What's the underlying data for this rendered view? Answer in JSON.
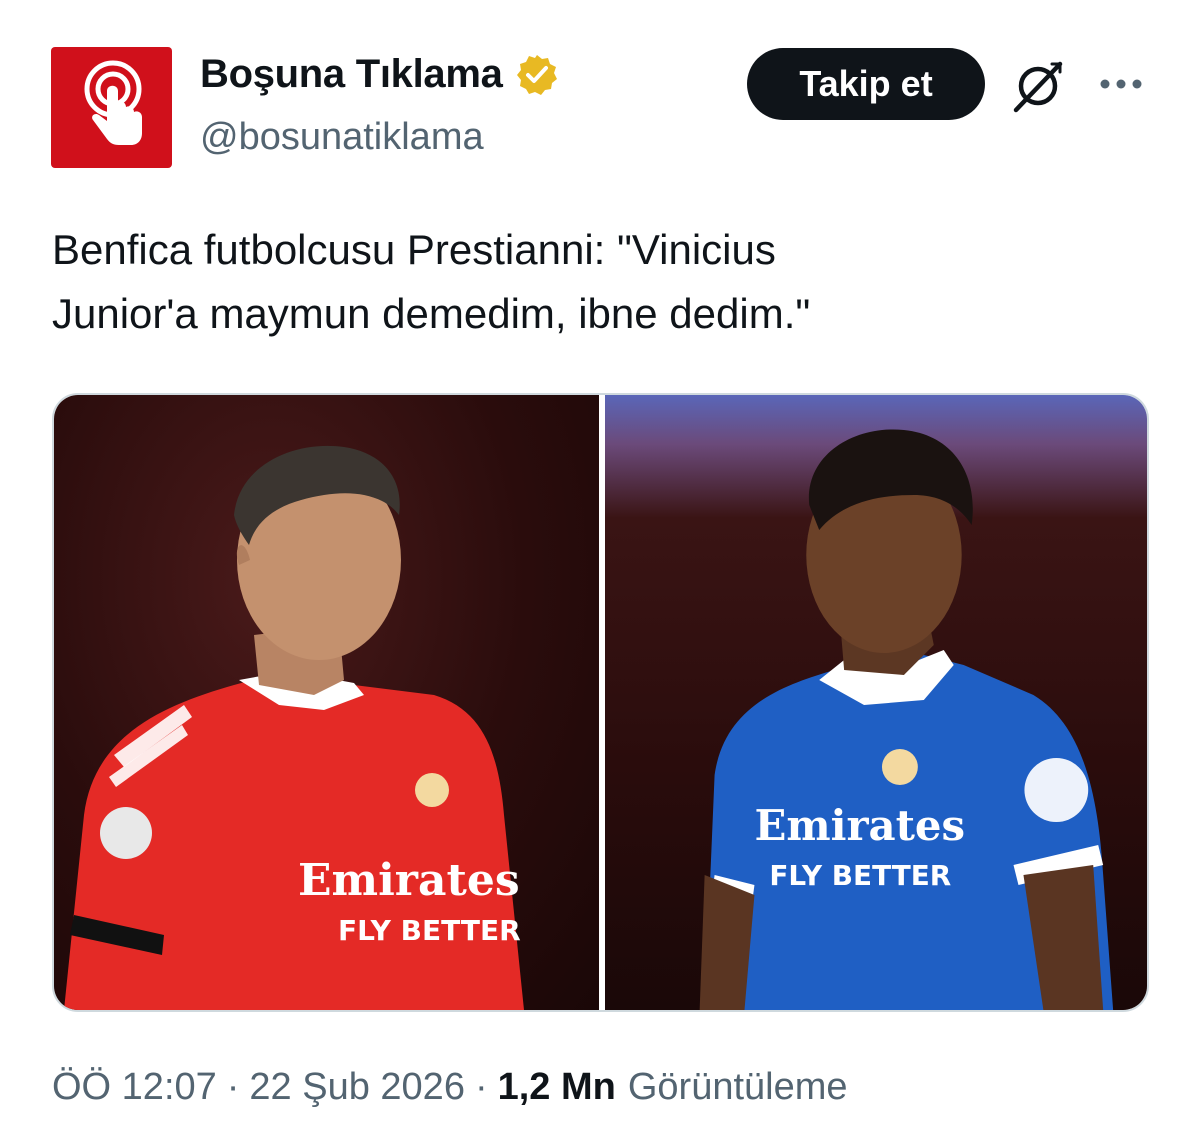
{
  "author": {
    "display_name": "Boşuna Tıklama",
    "handle": "@bosunatiklama",
    "verified_color": "#e8b923",
    "avatar_color": "#d0101b",
    "avatar_icon": "tap-hand-icon"
  },
  "actions": {
    "follow_label": "Takip et",
    "grok_icon": "grok-icon",
    "more_icon": "more-icon"
  },
  "tweet": {
    "text": "Benfica futbolcusu Prestianni: \"Vinicius\nJunior'a maymun demedim, ibne dedim.\""
  },
  "media": {
    "images": [
      {
        "subject": "player-red-kit",
        "jersey_sponsor_line1": "Emirates",
        "jersey_sponsor_line2": "FLY BETTER",
        "kit_color": "#e42a26"
      },
      {
        "subject": "player-blue-kit",
        "jersey_sponsor_line1": "Emirates",
        "jersey_sponsor_line2": "FLY BETTER",
        "kit_color": "#1f5fc4"
      }
    ]
  },
  "meta": {
    "time": "ÖÖ 12:07",
    "separator": "·",
    "date": "22 Şub 2026",
    "views_count": "1,2 Mn",
    "views_label": "Görüntüleme"
  }
}
